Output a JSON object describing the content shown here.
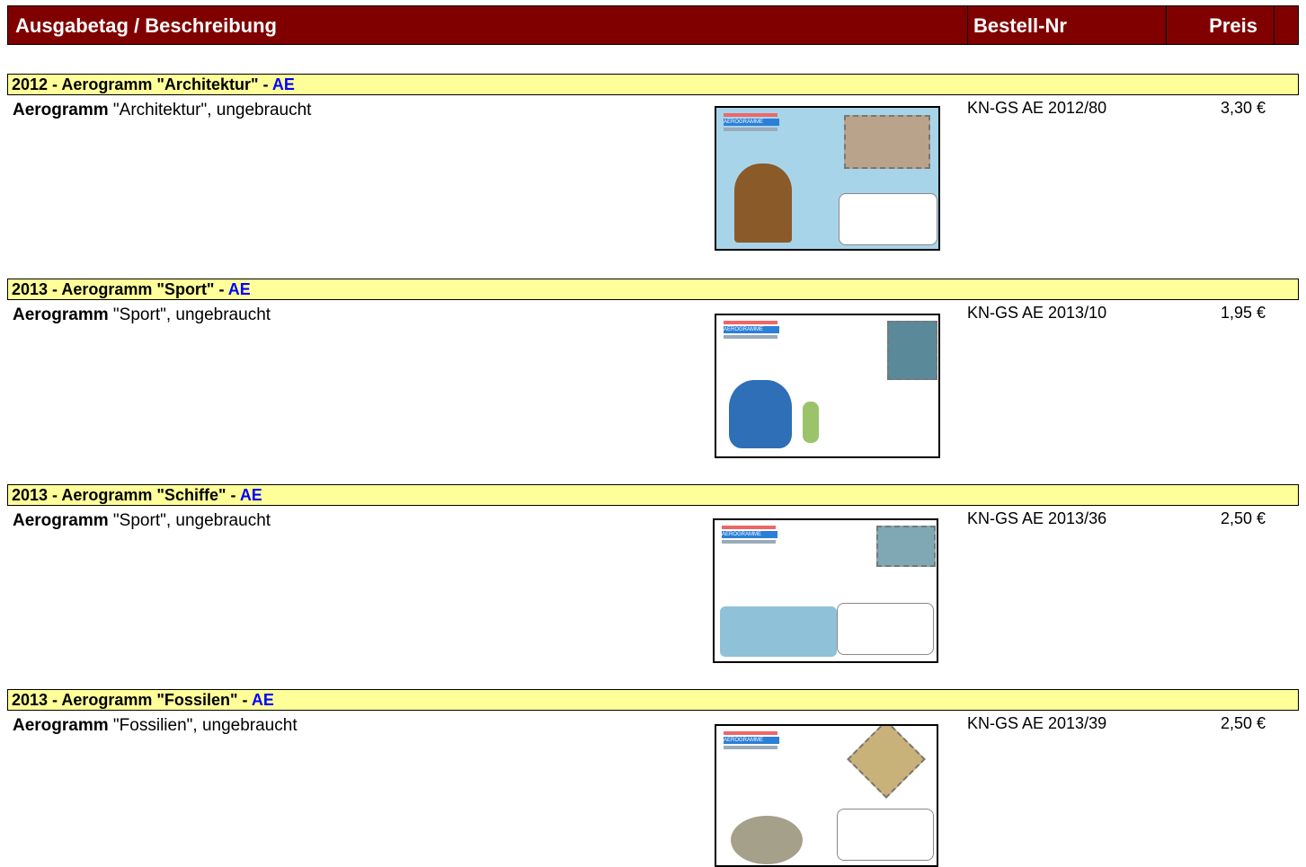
{
  "header": {
    "description": "Ausgabetag / Beschreibung",
    "order_no": "Bestell-Nr",
    "price": "Preis"
  },
  "sections": [
    {
      "title": "2012 - Aerogramm \"Architektur\" - ",
      "tag": "AE",
      "item_bold": "Aerogramm",
      "item_text": " \"Architektur\", ungebraucht",
      "order": "KN-GS AE 2012/80",
      "price": "3,30 €"
    },
    {
      "title": "2013 - Aerogramm \"Sport\" - ",
      "tag": "AE",
      "item_bold": "Aerogramm",
      "item_text": " \"Sport\", ungebraucht",
      "order": "KN-GS AE 2013/10",
      "price": "1,95 €"
    },
    {
      "title": "2013 - Aerogramm \"Schiffe\" - ",
      "tag": "AE",
      "item_bold": "Aerogramm",
      "item_text": " \"Sport\", ungebraucht",
      "order": "KN-GS AE 2013/36",
      "price": "2,50 €"
    },
    {
      "title": "2013 - Aerogramm \"Fossilen\" - ",
      "tag": "AE",
      "item_bold": "Aerogramm",
      "item_text": " \"Fossilien\", ungebraucht",
      "order": "KN-GS AE 2013/39",
      "price": "2,50 €"
    }
  ],
  "card_label": "AEROGRAMME",
  "colors": {
    "header_bg": "#800000",
    "section_bg": "#ffff99",
    "tag_color": "#0000ff"
  }
}
